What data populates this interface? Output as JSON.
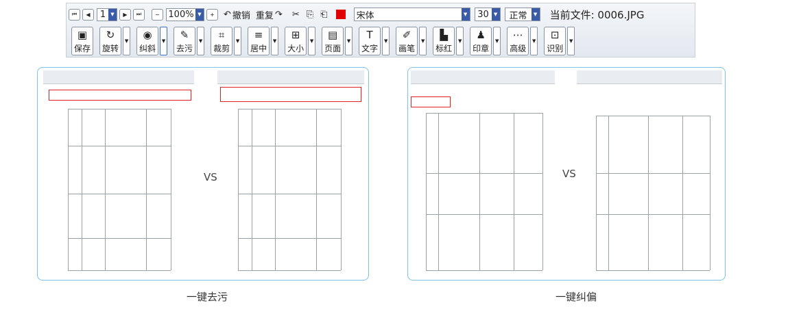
{
  "toolbar": {
    "page_value": "1",
    "zoom_value": "100%",
    "undo_label": "撤销",
    "redo_label": "重复",
    "font_name": "宋体",
    "font_size": "30",
    "font_style": "正常",
    "current_file_label": "当前文件:",
    "current_file_name": "0006.JPG",
    "color_accent": "#e00000"
  },
  "tools": [
    {
      "name": "save",
      "icon": "▣",
      "label": "保存"
    },
    {
      "name": "rotate",
      "icon": "↻",
      "label": "旋转"
    },
    {
      "name": "deskew",
      "icon": "◉",
      "label": "纠斜"
    },
    {
      "name": "clean",
      "icon": "✎",
      "label": "去污"
    },
    {
      "name": "crop",
      "icon": "⌗",
      "label": "裁剪"
    },
    {
      "name": "center",
      "icon": "≡",
      "label": "居中"
    },
    {
      "name": "size",
      "icon": "⊞",
      "label": "大小"
    },
    {
      "name": "page",
      "icon": "▤",
      "label": "页面"
    },
    {
      "name": "text",
      "icon": "T",
      "label": "文字"
    },
    {
      "name": "pen",
      "icon": "✐",
      "label": "画笔"
    },
    {
      "name": "redmark",
      "icon": "▙",
      "label": "标红"
    },
    {
      "name": "stamp",
      "icon": "♟",
      "label": "印章"
    },
    {
      "name": "advanced",
      "icon": "⋯",
      "label": "高级"
    },
    {
      "name": "ocr",
      "icon": "⊡",
      "label": "识别"
    }
  ],
  "panels": {
    "vs_left": "VS",
    "vs_right": "VS",
    "caption_left": "一键去污",
    "caption_right": "一键纠偏"
  }
}
